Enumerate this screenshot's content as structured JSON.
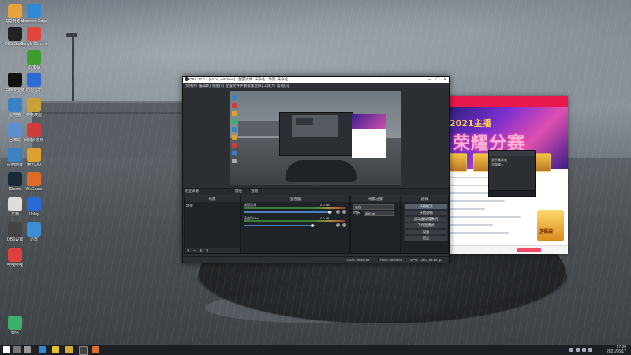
{
  "desktop": {
    "icons": [
      {
        "label": "QQ浏览器"
      },
      {
        "label": "Microsoft Edge"
      },
      {
        "label": "OBS Studio"
      },
      {
        "label": "Google Chrome"
      },
      {
        "label": "NVIDIA"
      },
      {
        "label": "剪映专业版"
      },
      {
        "label": "酷狗音乐"
      },
      {
        "label": "此电脑"
      },
      {
        "label": "英雄联盟"
      },
      {
        "label": "回收站"
      },
      {
        "label": "网易云音乐"
      },
      {
        "label": "控制面板"
      },
      {
        "label": "腾讯QQ"
      },
      {
        "label": "Steam"
      },
      {
        "label": "WeGame"
      },
      {
        "label": "文档"
      },
      {
        "label": "Uplay"
      },
      {
        "label": "OBS设置"
      },
      {
        "label": "迅雷"
      },
      {
        "label": "哔哩哔哩"
      },
      {
        "label": "微信"
      }
    ]
  },
  "obs": {
    "title": "OBS 27.0.1 (64 bit, windows) - 配置文件: 未命名 - 场景: 未命名",
    "minimize": "—",
    "maximize": "☐",
    "close": "✕",
    "menu": [
      "文件(F)",
      "编辑(E)",
      "视图(V)",
      "配置文件(P)",
      "场景集合(S)",
      "工具(T)",
      "帮助(H)"
    ],
    "dock_labels": {
      "scene_label": "无选择源",
      "props_button": "属性",
      "filters_button": "滤镜"
    },
    "scenes": {
      "header": "场景",
      "items": [
        "场景"
      ]
    },
    "mixer": {
      "header": "混音器",
      "tracks": [
        {
          "name": "桌面音频",
          "db": "0.0 dB",
          "level": 0.82
        },
        {
          "name": "麦克风/Aux",
          "db": "0.0 dB",
          "level": 0.7
        }
      ]
    },
    "transitions": {
      "header": "场景过渡",
      "type_label": "淡出",
      "duration_label": "时长",
      "duration_value": "300 ms"
    },
    "controls": {
      "header": "控件",
      "buttons": [
        "开始推流",
        "开始录制",
        "启动虚拟摄像机",
        "工作室模式",
        "设置",
        "退出"
      ]
    },
    "status": {
      "live": "LIVE: 00:00:00",
      "rec": "REC: 00:00:00",
      "cpu": "CPU: 1.3%, 30.00 fps"
    }
  },
  "live_window": {
    "banner_sub": "2021主播",
    "banner_title": "荣耀分赛",
    "gift_label": "送福袋"
  },
  "float_panel": {
    "rows": [
      "显示器采集",
      "音频输入"
    ]
  },
  "taskbar": {
    "time": "17:00",
    "date": "2021/06/17"
  }
}
